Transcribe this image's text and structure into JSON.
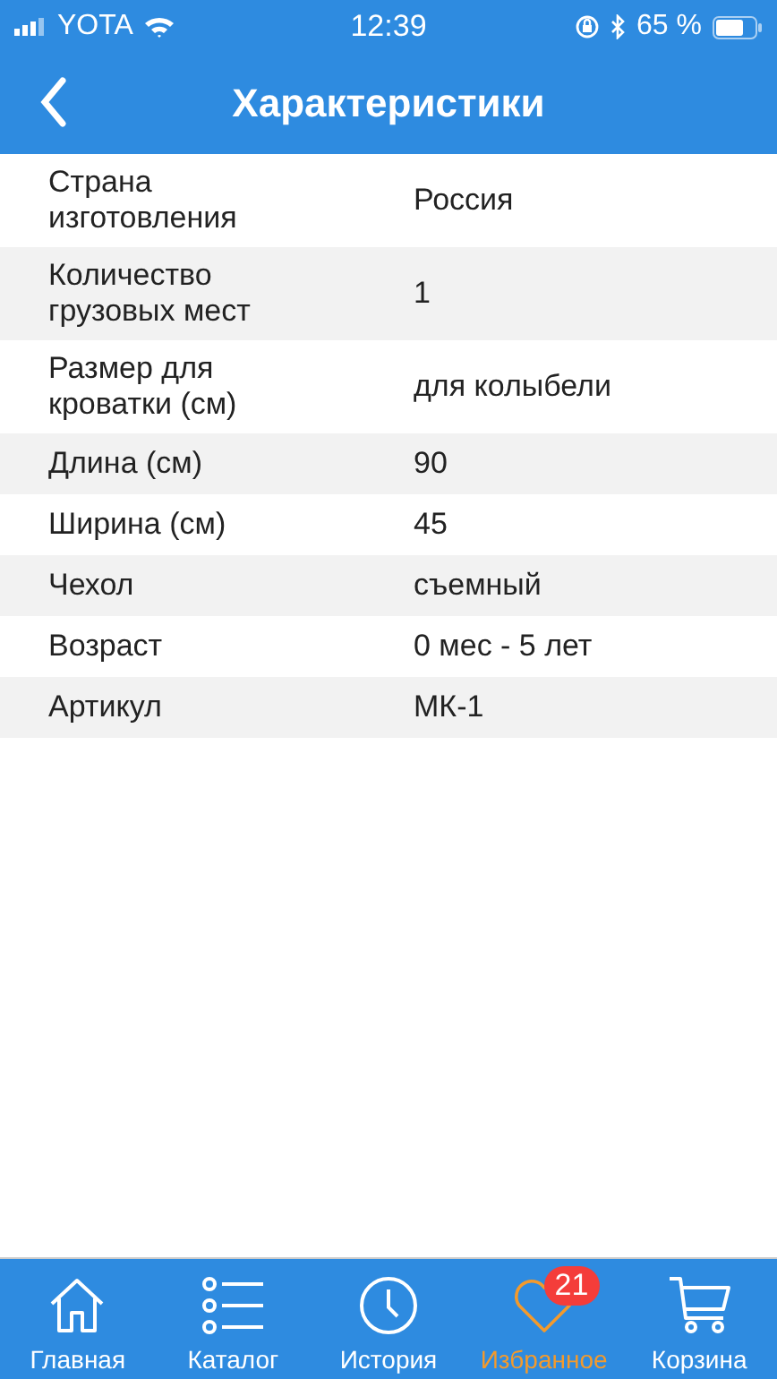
{
  "status_bar": {
    "carrier": "YOTA",
    "time": "12:39",
    "battery": "65 %"
  },
  "nav": {
    "title": "Характеристики"
  },
  "specs": [
    {
      "label": "Страна изготовления",
      "value": "Россия"
    },
    {
      "label": "Количество грузовых мест",
      "value": "1"
    },
    {
      "label": "Размер для кроватки (см)",
      "value": "для колыбели"
    },
    {
      "label": "Длина (см)",
      "value": "90"
    },
    {
      "label": "Ширина (см)",
      "value": "45"
    },
    {
      "label": "Чехол",
      "value": "съемный"
    },
    {
      "label": "Возраст",
      "value": "0 мес - 5 лет"
    },
    {
      "label": "Артикул",
      "value": "МК-1"
    }
  ],
  "tabs": [
    {
      "kind": "home",
      "label": "Главная",
      "selected": false
    },
    {
      "kind": "catalog",
      "label": "Каталог",
      "selected": false
    },
    {
      "kind": "history",
      "label": "История",
      "selected": false
    },
    {
      "kind": "favorites",
      "label": "Избранное",
      "selected": true,
      "badge": "21"
    },
    {
      "kind": "cart",
      "label": "Корзина",
      "selected": false
    }
  ]
}
